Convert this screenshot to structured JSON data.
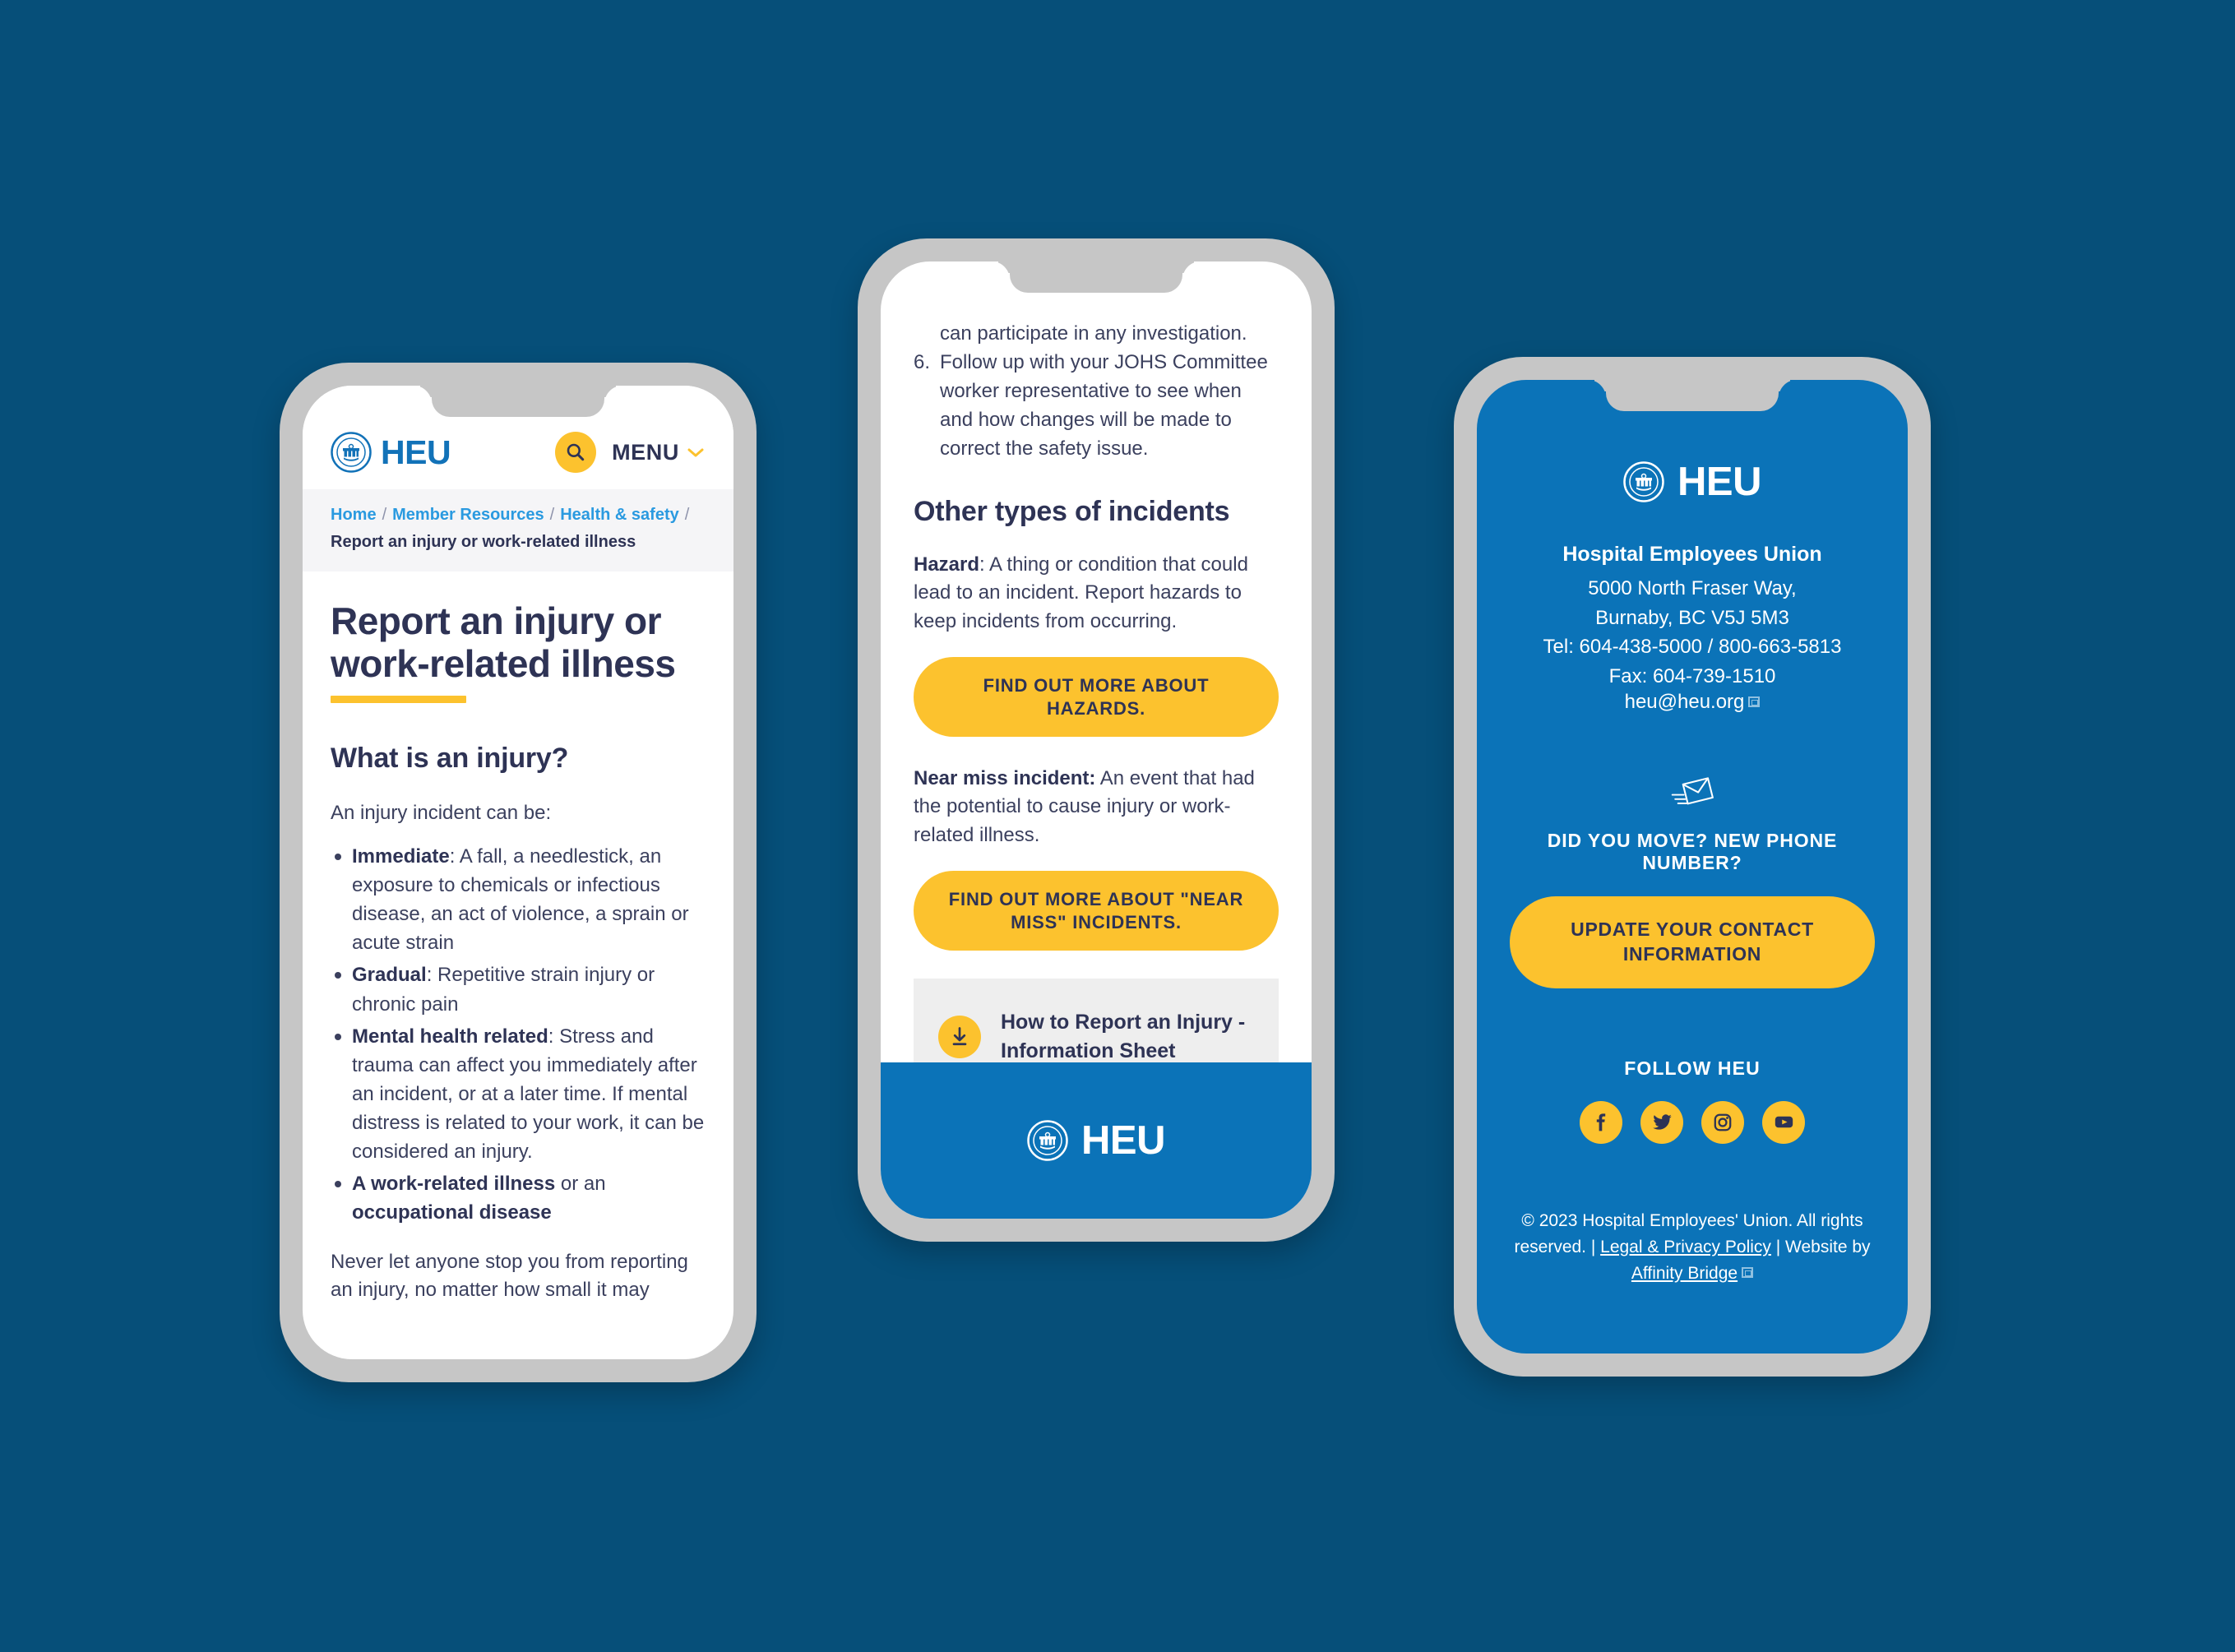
{
  "background_color": "#064f79",
  "brand": {
    "name": "HEU",
    "seal_text_top": "HOSPITAL EMPLOYEES' UNION",
    "seal_text_bottom": "CUPE",
    "logo_blue": "#1272b8",
    "accent_yellow": "#fcc22e",
    "screen_blue": "#0b73b8",
    "text_dark": "#2e3355"
  },
  "phone1": {
    "header": {
      "brand_word": "HEU",
      "search_icon": "search-icon",
      "menu_label": "MENU",
      "chevron_icon": "chevron-down-icon"
    },
    "breadcrumb": {
      "items": [
        "Home",
        "Member Resources",
        "Health & safety"
      ],
      "separator": "/",
      "current": "Report an injury or work-related illness"
    },
    "page_title": "Report an injury or work-related illness",
    "section_heading": "What is an injury?",
    "intro": "An injury incident can be:",
    "bullets": [
      {
        "lead": "Immediate",
        "rest": ": A fall, a needlestick, an exposure to chemicals or infectious disease, an act of violence, a sprain or acute strain"
      },
      {
        "lead": "Gradual",
        "rest": ": Repetitive strain injury or chronic pain"
      },
      {
        "lead": "Mental health related",
        "rest": ": Stress and trauma can affect you immediately after an incident, or at a later time. If mental distress is related to your work, it can be considered an injury."
      },
      {
        "lead": "A work-related illness",
        "rest": " or an",
        "lead2": "occupational disease"
      }
    ],
    "trailing_paragraph": "Never let anyone stop you from reporting an injury, no matter how small it may"
  },
  "phone2": {
    "continued_line": "can participate in any investigation.",
    "step": {
      "number": "6.",
      "text": "Follow up with your JOHS Committee worker representative to see when and how  changes will be made to correct the safety issue."
    },
    "heading": "Other types of incidents",
    "hazard": {
      "lead": "Hazard",
      "rest": ": A thing or condition that could lead to an incident. Report hazards to keep incidents from occurring.",
      "button": "FIND OUT MORE ABOUT HAZARDS."
    },
    "near_miss": {
      "lead": "Near miss incident:",
      "rest": " An event that had the potential to cause injury or work-related illness.",
      "button": "FIND OUT MORE ABOUT \"NEAR MISS\" INCIDENTS."
    },
    "download_card": {
      "icon": "download-icon",
      "title": "How to Report an Injury - Information Sheet"
    },
    "footer_brand": "HEU"
  },
  "phone3": {
    "brand_word": "HEU",
    "org_name": "Hospital Employees Union",
    "address_line1": "5000 North Fraser Way,",
    "address_line2": "Burnaby, BC  V5J 5M3",
    "tel_line": "Tel: 604-438-5000 / 800-663-5813",
    "fax_line": "Fax: 604-739-1510",
    "email": "heu@heu.org",
    "mail_icon": "envelope-icon",
    "move_prompt": "DID YOU MOVE? NEW PHONE NUMBER?",
    "update_button": "UPDATE YOUR CONTACT INFORMATION",
    "follow_title": "FOLLOW HEU",
    "social": [
      {
        "name": "facebook-icon",
        "label": "Facebook"
      },
      {
        "name": "twitter-icon",
        "label": "Twitter"
      },
      {
        "name": "instagram-icon",
        "label": "Instagram"
      },
      {
        "name": "youtube-icon",
        "label": "YouTube"
      }
    ],
    "copyright_part1": "© 2023 Hospital Employees' Union. All rights reserved. | ",
    "legal_link": "Legal & Privacy Policy",
    "copyright_part2": " | Website by ",
    "agency_link": "Affinity Bridge"
  }
}
